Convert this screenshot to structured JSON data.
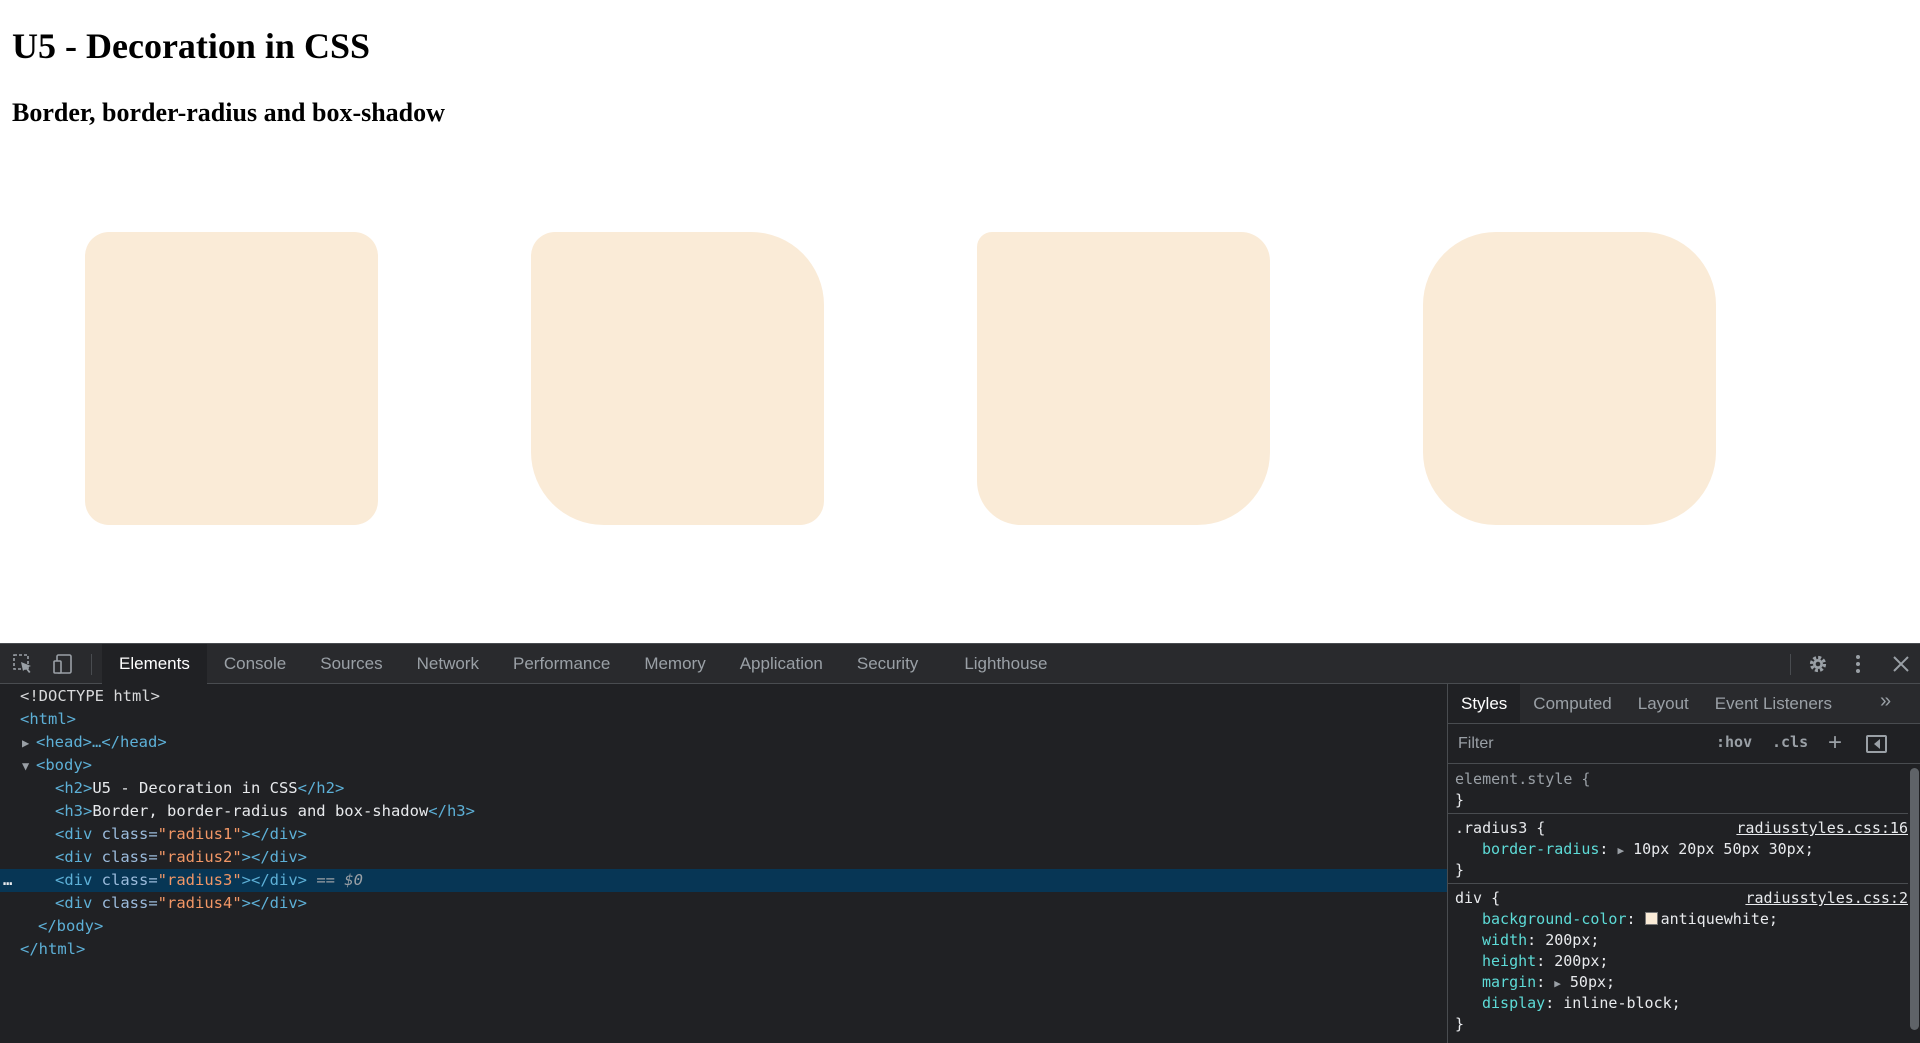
{
  "page": {
    "h2": "U5 - Decoration in CSS",
    "h3": "Border, border-radius and box-shadow",
    "box_color": "#faebd7"
  },
  "devtools": {
    "tabs": [
      "Elements",
      "Console",
      "Sources",
      "Network",
      "Performance",
      "Memory",
      "Application",
      "Security",
      "Lighthouse"
    ],
    "active_tab": "Elements",
    "dom": {
      "doctype": "<!DOCTYPE html>",
      "html_open": "<html>",
      "head": "<head>…</head>",
      "body_open": "<body>",
      "h2_tag_open": "<h2>",
      "h2_text": "U5 - Decoration in CSS",
      "h2_tag_close": "</h2>",
      "h3_tag_open": "<h3>",
      "h3_text": "Border, border-radius and box-shadow",
      "h3_tag_close": "</h3>",
      "div_open": "<div ",
      "class_attr": "class=",
      "div_close": "></div>",
      "radius1": "\"radius1\"",
      "radius2": "\"radius2\"",
      "radius3": "\"radius3\"",
      "radius4": "\"radius4\"",
      "selected_marker": " == $0",
      "dots": "…",
      "body_close": "</body>",
      "html_close": "</html>"
    },
    "styles_tabs": [
      "Styles",
      "Computed",
      "Layout",
      "Event Listeners"
    ],
    "more_tabs": "»",
    "filter_placeholder": "Filter",
    "hov": ":hov",
    "cls": ".cls",
    "rules": {
      "element_style": "element.style {",
      "close_brace": "}",
      "radius3_selector": ".radius3 {",
      "radius3_source": "radiusstyles.css:16",
      "border_radius_name": "border-radius",
      "border_radius_value": "10px 20px 50px 30px;",
      "div_selector": "div {",
      "div_source": "radiusstyles.css:2",
      "bg_name": "background-color",
      "bg_value": "antiquewhite;",
      "bg_swatch_color": "#faebd7",
      "width_name": "width",
      "width_value": "200px;",
      "height_name": "height",
      "height_value": "200px;",
      "margin_name": "margin",
      "margin_value": "50px;",
      "display_name": "display",
      "display_value": "inline-block;"
    }
  }
}
